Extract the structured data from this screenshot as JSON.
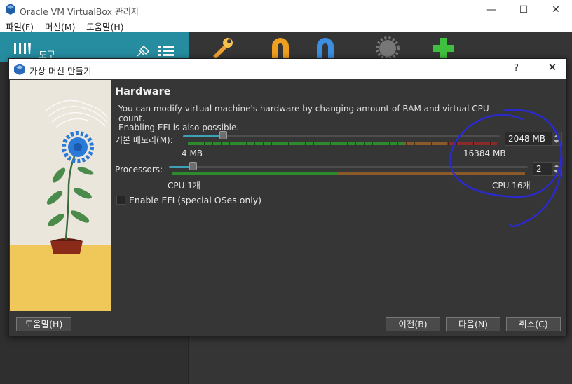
{
  "window": {
    "title": "Oracle VM VirtualBox 관리자",
    "minimize": "—",
    "maximize": "☐",
    "close": "✕"
  },
  "menu": {
    "file": "파일(F)",
    "machine": "머신(M)",
    "help": "도움말(H)"
  },
  "sidebar": {
    "tools_label": "도구"
  },
  "dialog": {
    "title": "가상 머신 만들기",
    "help_glyph": "?",
    "close_glyph": "✕",
    "heading": "Hardware",
    "description_line1": "You can modify virtual machine's hardware by changing amount of RAM and virtual CPU count.",
    "description_line2": "Enabling EFI is also possible.",
    "memory": {
      "label": "기본 메모리(M):",
      "value": "2048 MB",
      "min_label": "4 MB",
      "max_label": "16384 MB",
      "fraction": 0.125
    },
    "processors": {
      "label": "Processors:",
      "value": "2",
      "min_label": "CPU 1개",
      "max_label": "CPU 16개",
      "fraction": 0.0667
    },
    "efi": {
      "label": "Enable EFI (special OSes only)",
      "checked": false
    },
    "buttons": {
      "help": "도움말(H)",
      "back": "이전(B)",
      "next": "다음(N)",
      "cancel": "취소(C)"
    }
  },
  "colors": {
    "accent": "#268da1",
    "slider_fill": "#3fa1b7",
    "annotation": "#2a2acf"
  }
}
